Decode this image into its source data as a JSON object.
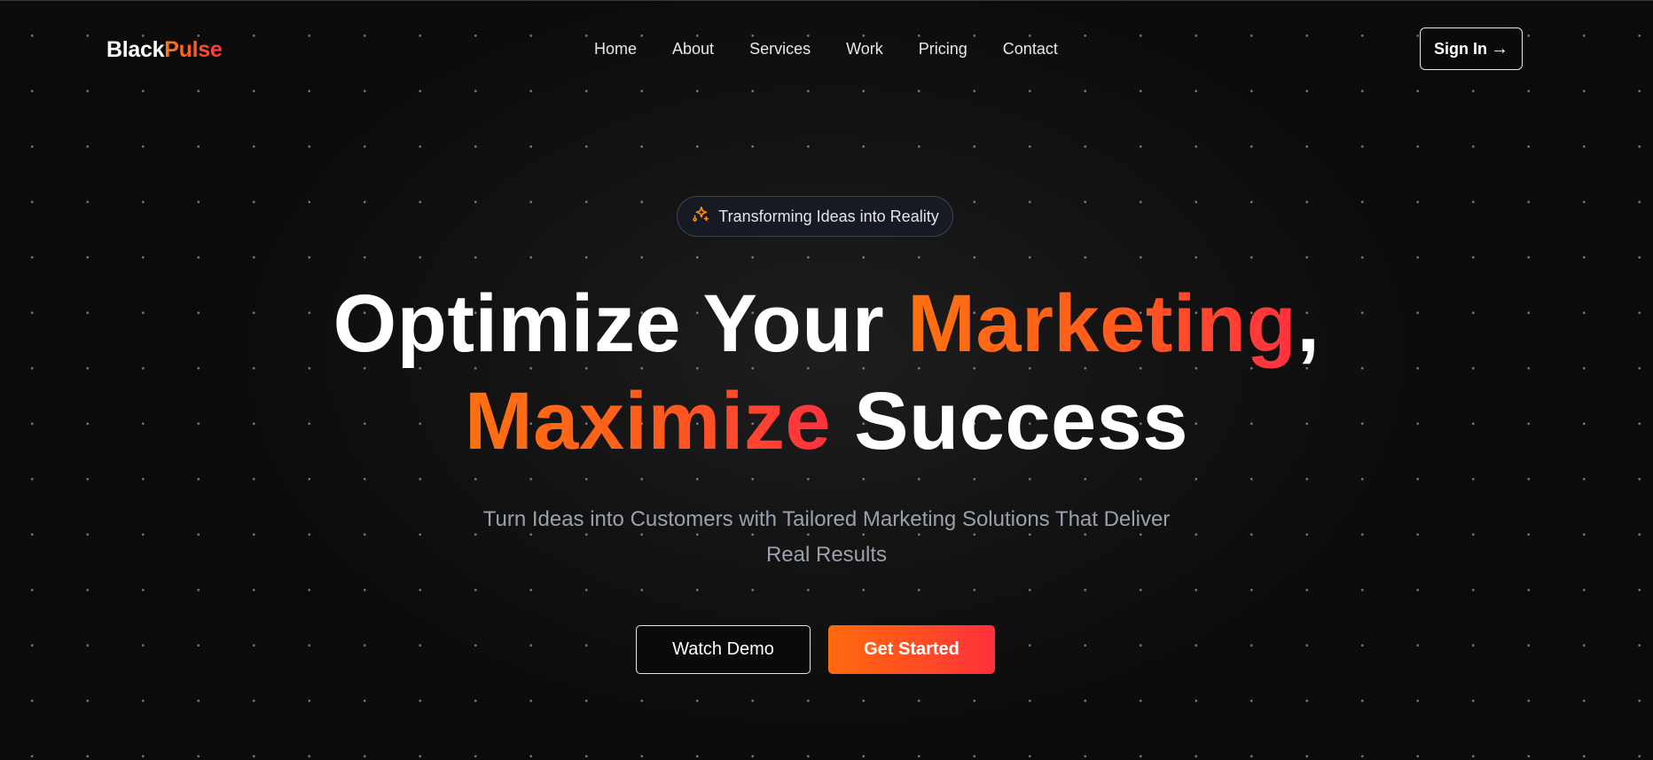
{
  "brand": {
    "name_part1": "Black",
    "name_part2": "Pulse",
    "accent_gradient": [
      "#ff7a12",
      "#ff3838"
    ]
  },
  "nav": {
    "links": [
      {
        "label": "Home"
      },
      {
        "label": "About"
      },
      {
        "label": "Services"
      },
      {
        "label": "Work"
      },
      {
        "label": "Pricing"
      },
      {
        "label": "Contact"
      }
    ],
    "signin_label": "Sign In",
    "signin_arrow": "→"
  },
  "badge": {
    "icon": "sparkles-icon",
    "text": "Transforming Ideas into Reality"
  },
  "hero": {
    "line1_part1": "Optimize Your ",
    "line1_highlight": "Marketing",
    "line1_part2": ",",
    "line2_highlight": "Maximize",
    "line2_part2": " Success",
    "subtitle_line1": "Turn Ideas into Customers with Tailored Marketing Solutions That Deliver",
    "subtitle_line2": "Real Results"
  },
  "cta": {
    "secondary_label": "Watch Demo",
    "primary_label": "Get Started"
  },
  "colors": {
    "background": "#0a0a0a",
    "accent_orange": "#ff6a0c",
    "accent_red": "#ff2f3e",
    "subtitle": "#9aa1ad"
  }
}
